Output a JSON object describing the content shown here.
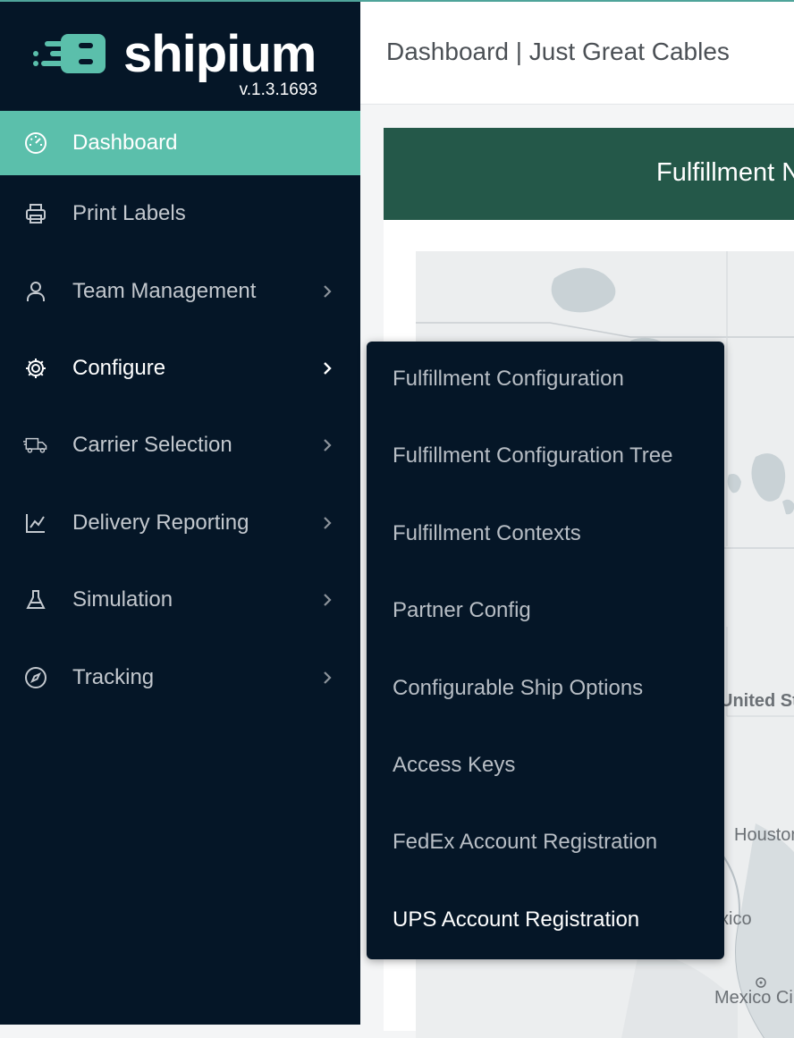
{
  "brand": {
    "name": "shipium",
    "version": "v.1.3.1693"
  },
  "header": {
    "title": "Dashboard | Just Great Cables"
  },
  "sidebar": {
    "items": [
      {
        "label": "Dashboard",
        "icon": "dashboard-gauge-icon",
        "state": "active"
      },
      {
        "label": "Print Labels",
        "icon": "printer-icon"
      },
      {
        "label": "Team Management",
        "icon": "user-icon",
        "has_children": true
      },
      {
        "label": "Configure",
        "icon": "gear-icon",
        "has_children": true,
        "state": "open"
      },
      {
        "label": "Carrier Selection",
        "icon": "truck-icon",
        "has_children": true
      },
      {
        "label": "Delivery Reporting",
        "icon": "line-chart-icon",
        "has_children": true
      },
      {
        "label": "Simulation",
        "icon": "flask-icon",
        "has_children": true
      },
      {
        "label": "Tracking",
        "icon": "compass-icon",
        "has_children": true
      }
    ]
  },
  "configure_menu": {
    "items": [
      "Fulfillment Configuration",
      "Fulfillment Configuration Tree",
      "Fulfillment Contexts",
      "Partner Config",
      "Configurable Ship Options",
      "Access Keys",
      "FedEx Account Registration",
      "UPS Account Registration"
    ],
    "hovered": "UPS Account Registration"
  },
  "card": {
    "title": "Fulfillment N"
  },
  "map": {
    "labels": {
      "country": "United St",
      "city_houston": "Houston",
      "country_mexico": "xico",
      "city_mexico": "Mexico Ci"
    }
  },
  "colors": {
    "sidebar_bg": "#051627",
    "accent": "#5bbfab",
    "card_header": "#245849"
  }
}
